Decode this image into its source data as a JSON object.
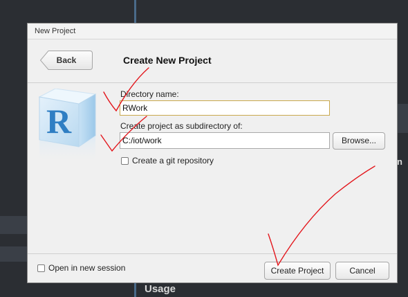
{
  "background": {
    "usage_label": "Usage",
    "right_edge_letter": "n"
  },
  "dialog": {
    "window_title": "New Project",
    "back_label": "Back",
    "title": "Create New Project",
    "directory_name": {
      "label": "Directory name:",
      "value": "RWork"
    },
    "parent_dir": {
      "label": "Create project as subdirectory of:",
      "value": "C:/iot/work"
    },
    "browse_label": "Browse...",
    "git_checkbox": {
      "label": "Create a git repository",
      "checked": false
    },
    "new_session_checkbox": {
      "label": "Open in new session",
      "checked": false
    },
    "create_label": "Create Project",
    "cancel_label": "Cancel",
    "logo_letter": "R"
  },
  "colors": {
    "ide_background": "#2b2e33",
    "annotation": "#e3161c",
    "focus_border": "#c9a84c",
    "logo_blue": "#2f7ec3"
  }
}
